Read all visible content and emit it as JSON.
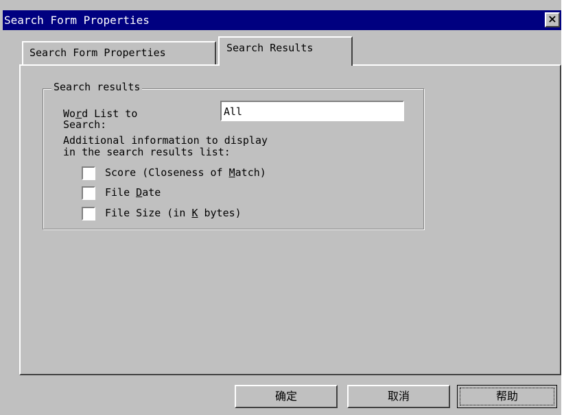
{
  "window": {
    "title": "Search Form Properties",
    "close_glyph": "×"
  },
  "tabs": [
    {
      "label": "Search Form Properties",
      "selected": false
    },
    {
      "label": "Search Results",
      "selected": true
    }
  ],
  "group": {
    "legend": "Search results",
    "word_list_label_pre": "Wo",
    "word_list_label_key": "r",
    "word_list_label_post": "d List to",
    "word_list_label_line2": "Search:",
    "word_list_value": "All",
    "additional_info_line1": "Additional information to display",
    "additional_info_line2": "in the search results list:",
    "checkboxes": [
      {
        "pre": "Score (Closeness of ",
        "key": "M",
        "post": "atch)",
        "checked": false
      },
      {
        "pre": "File ",
        "key": "D",
        "post": "ate",
        "checked": false
      },
      {
        "pre": "File Size (in ",
        "key": "K",
        "post": " bytes)",
        "checked": false
      }
    ]
  },
  "buttons": {
    "ok": "确定",
    "cancel": "取消",
    "help": "帮助"
  }
}
